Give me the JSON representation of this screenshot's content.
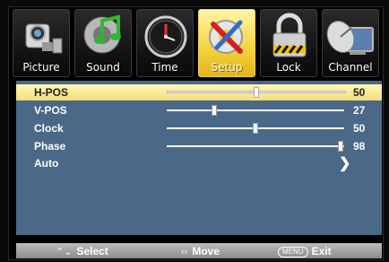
{
  "tabs": [
    {
      "label": "Picture",
      "icon": "camcorder-icon"
    },
    {
      "label": "Sound",
      "icon": "music-note-icon"
    },
    {
      "label": "Time",
      "icon": "clock-icon"
    },
    {
      "label": "Setup",
      "icon": "wrench-screwdriver-icon",
      "selected": true
    },
    {
      "label": "Lock",
      "icon": "padlock-icon"
    },
    {
      "label": "Channel",
      "icon": "satellite-dish-icon"
    }
  ],
  "menu": {
    "hpos": {
      "label": "H-POS",
      "value": "50",
      "level": 50
    },
    "vpos": {
      "label": "V-POS",
      "value": "27",
      "level": 27
    },
    "clock": {
      "label": "Clock",
      "value": "50",
      "level": 50
    },
    "phase": {
      "label": "Phase",
      "value": "98",
      "level": 98
    },
    "auto": {
      "label": "Auto",
      "icon": "chevron-right-icon"
    }
  },
  "footer": {
    "select": {
      "glyph": "⌃⌄",
      "label": "Select"
    },
    "move": {
      "glyph": "‹›",
      "label": "Move"
    },
    "exit": {
      "key": "MENU",
      "label": "Exit"
    }
  },
  "colors": {
    "menu_background": "#4a6888",
    "selected_row": "#f4dd7a",
    "selected_tab": "#f3d23a",
    "footer": "#a4a4a4"
  }
}
